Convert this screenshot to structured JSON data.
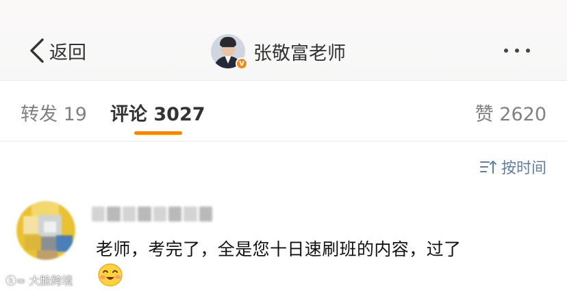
{
  "header": {
    "back_label": "返回",
    "username": "张敬富老师",
    "verified_badge": "V",
    "more_icon": "more-dots-icon",
    "colors": {
      "badge": "#f08a1c"
    }
  },
  "tabs": {
    "repost": "转发 19",
    "comment": "评论 3027",
    "like": "赞 2620",
    "active": "comment",
    "indicator_color": "#ff8200"
  },
  "sort": {
    "label": "按时间",
    "icon": "sort-time-icon",
    "color": "#5d7fa6"
  },
  "comment": {
    "text": "老师，考完了，全是您十日速刷班的内容，过了",
    "emoji": "smile-blush-emoji"
  },
  "watermark": "大脸跨境"
}
